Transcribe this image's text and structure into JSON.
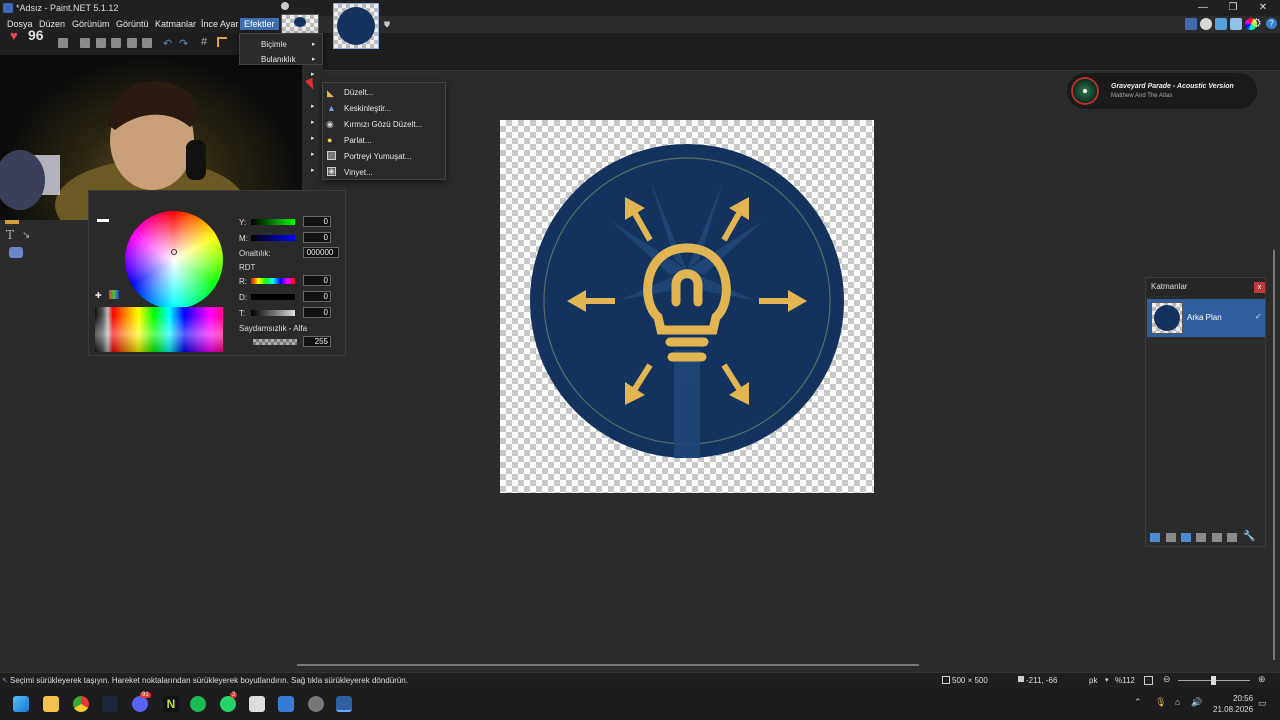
{
  "window": {
    "title": "*Adsız - Paint.NET 5.1.12"
  },
  "menu": {
    "items": [
      "Dosya",
      "Düzen",
      "Görünüm",
      "Görüntü",
      "Katmanlar",
      "İnce Ayar",
      "Efektler"
    ]
  },
  "effects_menu": {
    "items": [
      "Biçimle",
      "Bulanıklık"
    ]
  },
  "photo_submenu": {
    "items": [
      "Düzelt...",
      "Keskinleştir...",
      "Kırmızı Gözü Düzelt...",
      "Parlat...",
      "Portreyi Yumuşat...",
      "Vinyet..."
    ]
  },
  "overlay": {
    "likes_count": "96"
  },
  "colors_panel": {
    "y_label": "Y:",
    "m_label": "M:",
    "y_value": "0",
    "m_value": "0",
    "hex_label": "Onaltılık:",
    "hex_value": "000000",
    "rgb_header": "RDT",
    "r_label": "R:",
    "d_label": "D:",
    "t_label": "T:",
    "r_value": "0",
    "d_value": "0",
    "t_value": "0",
    "alpha_header": "Saydamsızlık - Alfa",
    "alpha_value": "255"
  },
  "now_playing": {
    "track": "Graveyard Parade - Acoustic Version",
    "artist": "Matthew And The Atlas"
  },
  "layers_panel": {
    "title": "Katmanlar",
    "layers": [
      {
        "name": "Arka Plan",
        "visible": true
      }
    ]
  },
  "status": {
    "hint": "Seçimi sürükleyerek taşıyın. Hareket noktalarından sürükleyerek boyutlandırın. Sağ tıkla sürükleyerek döndürün.",
    "image_size": "500 × 500",
    "cursor_pos": "-211, -66",
    "unit": "pk",
    "zoom": "%112"
  },
  "taskbar": {
    "time": "20:56",
    "date": "21.08.2026",
    "badge_discord": "91",
    "badge_whatsapp": "2"
  },
  "colors": {
    "accent": "#3d6fb0",
    "logo_navy": "#13335e",
    "logo_gold": "#e0b552"
  }
}
